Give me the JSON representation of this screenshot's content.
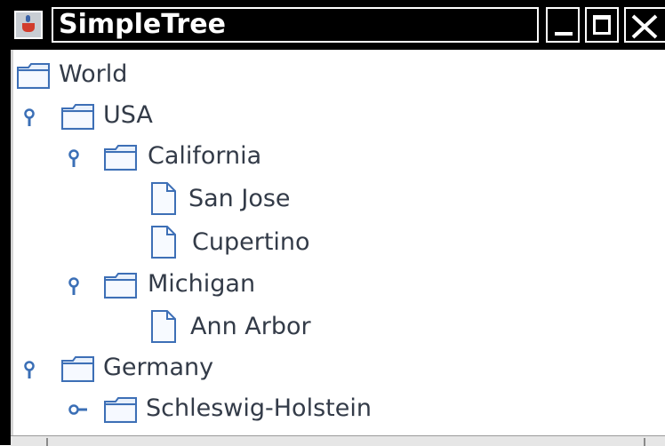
{
  "window": {
    "title": "SimpleTree"
  },
  "tree": {
    "nodes": [
      {
        "label": "World",
        "kind": "folder",
        "depth": 0,
        "handle": "none"
      },
      {
        "label": "USA",
        "kind": "folder",
        "depth": 1,
        "handle": "expanded"
      },
      {
        "label": "California",
        "kind": "folder",
        "depth": 2,
        "handle": "expanded"
      },
      {
        "label": "San Jose",
        "kind": "leaf",
        "depth": 3,
        "handle": "none"
      },
      {
        "label": "Cupertino",
        "kind": "leaf",
        "depth": 3,
        "handle": "none"
      },
      {
        "label": "Michigan",
        "kind": "folder",
        "depth": 2,
        "handle": "expanded"
      },
      {
        "label": "Ann Arbor",
        "kind": "leaf",
        "depth": 3,
        "handle": "none"
      },
      {
        "label": "Germany",
        "kind": "folder",
        "depth": 1,
        "handle": "expanded"
      },
      {
        "label": "Schleswig-Holstein",
        "kind": "folder",
        "depth": 2,
        "handle": "collapsed"
      }
    ]
  },
  "colors": {
    "titlebar": "#000000",
    "text": "#333b48",
    "icon_stroke": "#3b6fb6",
    "icon_fill": "#e8f0fb",
    "handle": "#3b6fb6"
  }
}
